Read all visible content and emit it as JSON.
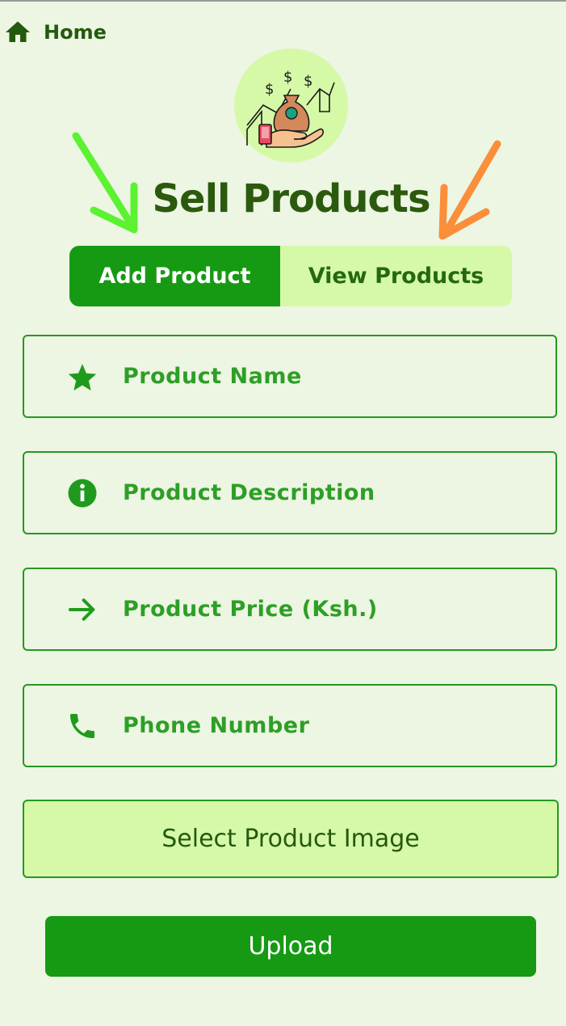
{
  "nav": {
    "home_label": "Home",
    "home_icon": "home-icon"
  },
  "header": {
    "title": "Sell Products",
    "logo_icon": "money-bag-hand-icon"
  },
  "tabs": [
    {
      "label": "Add Product",
      "active": true
    },
    {
      "label": "View Products",
      "active": false
    }
  ],
  "form": {
    "fields": [
      {
        "placeholder": "Product Name",
        "value": "",
        "icon": "star-icon"
      },
      {
        "placeholder": "Product Description",
        "value": "",
        "icon": "info-icon"
      },
      {
        "placeholder": "Product Price (Ksh.)",
        "value": "",
        "icon": "arrow-right-icon"
      },
      {
        "placeholder": "Phone Number",
        "value": "",
        "icon": "phone-icon"
      }
    ],
    "select_image_label": "Select Product Image",
    "upload_label": "Upload"
  },
  "colors": {
    "background": "#edf5e3",
    "primary": "#169a13",
    "tab_inactive": "#d6f9a8",
    "text_dark": "#235a0d",
    "annotation_green": "#5cf232",
    "annotation_orange": "#fa8f39"
  }
}
